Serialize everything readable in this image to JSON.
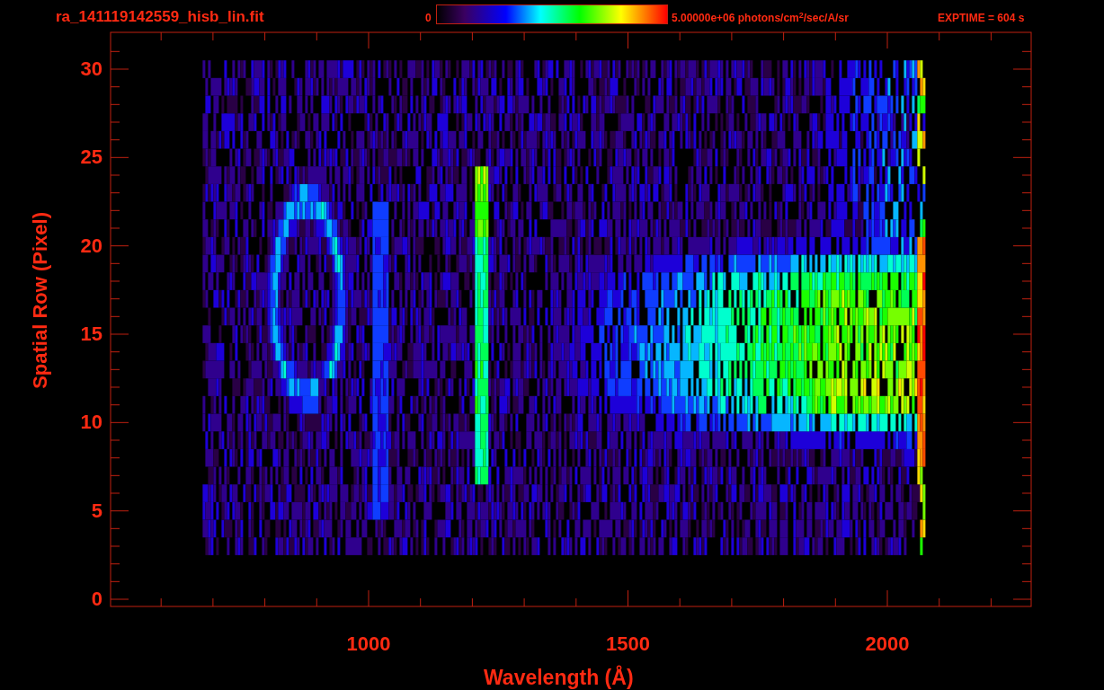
{
  "header": {
    "title": "ra_141119142559_hisb_lin.fit",
    "colorbar_min": "0",
    "colorbar_max": "5.00000e+06 photons/cm$^{2}$/sec/A/sr",
    "exptime": "EXPTIME = 604 s"
  },
  "plot": {
    "xlabel": "Wavelength (Å)",
    "ylabel": "Spatial Row (Pixel)",
    "xticks": [
      "1000",
      "1500",
      "2000"
    ],
    "yticks": [
      "30",
      "25",
      "20",
      "15",
      "10",
      "5",
      "0"
    ]
  }
}
